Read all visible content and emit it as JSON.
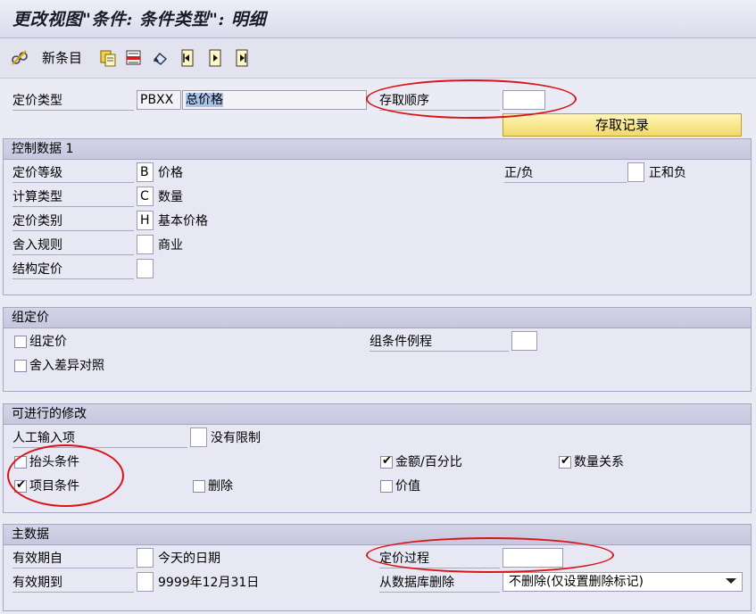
{
  "window": {
    "title": "更改视图\"条件: 条件类型\": 明细"
  },
  "toolbar": {
    "new_entries_label": "新条目",
    "icons": [
      "edit-glasses-icon",
      "copy-icon",
      "delete-icon",
      "undo-icon",
      "first-page-icon",
      "next-page-icon",
      "last-page-icon"
    ]
  },
  "header": {
    "pricing_type_label": "定价类型",
    "pricing_type_code": "PBXX",
    "pricing_type_name": "总价格",
    "access_sequence_label": "存取顺序",
    "access_sequence_value": "",
    "access_record_button": "存取记录"
  },
  "control_data": {
    "title": "控制数据 1",
    "level_label": "定价等级",
    "level_value": "B",
    "level_text": "价格",
    "calc_type_label": "计算类型",
    "calc_type_value": "C",
    "calc_type_text": "数量",
    "category_label": "定价类别",
    "category_value": "H",
    "category_text": "基本价格",
    "rounding_label": "舍入规则",
    "rounding_value": "",
    "rounding_text": "商业",
    "structure_label": "结构定价",
    "structure_value": "",
    "sign_label": "正/负",
    "sign_value": "",
    "sign_text": "正和负"
  },
  "group_pricing": {
    "title": "组定价",
    "group_cb_label": "组定价",
    "group_cb_checked": false,
    "rounding_diff_label": "舍入差异对照",
    "rounding_diff_checked": false,
    "routine_label": "组条件例程",
    "routine_value": ""
  },
  "changes": {
    "title": "可进行的修改",
    "manual_label": "人工输入项",
    "manual_value": "",
    "manual_text": "没有限制",
    "header_cond_label": "抬头条件",
    "header_cond_checked": false,
    "item_cond_label": "项目条件",
    "item_cond_checked": true,
    "delete_label": "删除",
    "delete_checked": false,
    "amount_label": "金额/百分比",
    "amount_checked": true,
    "value_label": "价值",
    "value_checked": false,
    "qty_rel_label": "数量关系",
    "qty_rel_checked": true
  },
  "master_data": {
    "title": "主数据",
    "valid_from_label": "有效期自",
    "valid_from_value": "",
    "valid_from_text": "今天的日期",
    "valid_to_label": "有效期到",
    "valid_to_value": "",
    "valid_to_text": "9999年12月31日",
    "pricing_proc_label": "定价过程",
    "pricing_proc_value": "",
    "delete_db_label": "从数据库删除",
    "delete_db_value": "不删除(仅设置删除标记)"
  },
  "colors": {
    "annotation_red": "#d91414",
    "group_header": "#c6c6de",
    "button_yellow": "#f1d96a"
  }
}
